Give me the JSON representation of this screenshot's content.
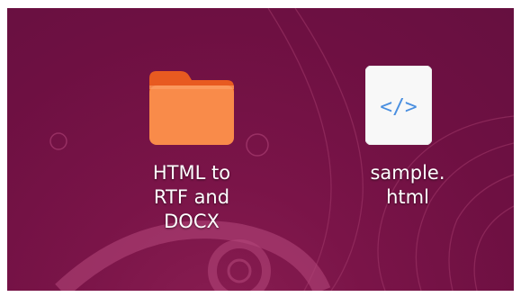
{
  "desktop": {
    "icons": [
      {
        "type": "folder",
        "icon": "folder-icon",
        "label": "HTML to\nRTF and\nDOCX",
        "color": "#f47a3b"
      },
      {
        "type": "file",
        "icon": "html-file-icon",
        "glyph": "</>",
        "label": "sample.\nhtml",
        "color": "#4a8fe0"
      }
    ]
  }
}
